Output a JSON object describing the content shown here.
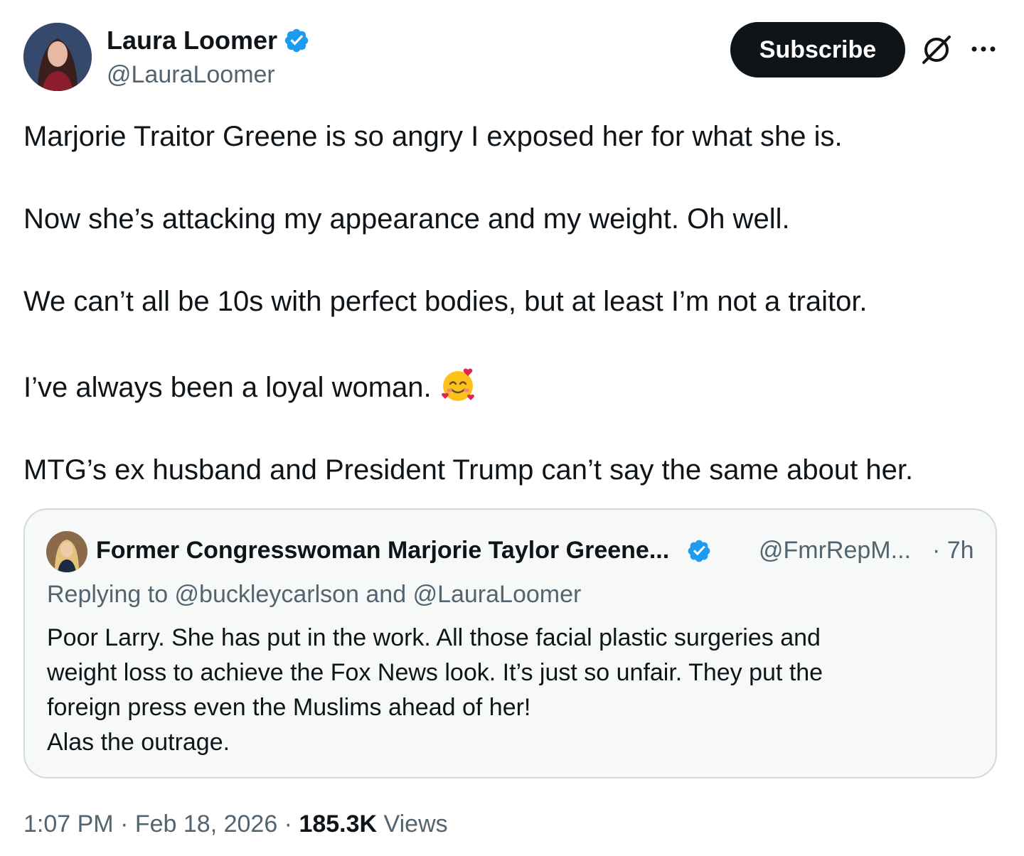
{
  "author": {
    "name": "Laura Loomer",
    "handle": "@LauraLoomer"
  },
  "actions": {
    "subscribe_label": "Subscribe"
  },
  "post": {
    "paragraphs": [
      "Marjorie Traitor Greene is so angry I exposed her for what she is.",
      "Now she’s attacking my appearance and my weight. Oh well.",
      "We can’t all be 10s with perfect bodies, but at least I’m not a traitor.",
      "I’ve always been a loyal woman.",
      "MTG’s ex husband and President Trump can’t say the same about her."
    ],
    "emoji_name": "smiling-face-with-hearts"
  },
  "quote": {
    "name": "Former Congresswoman Marjorie Taylor Greene...",
    "handle": "@FmrRepM...",
    "time": "· 7h",
    "replying_to": "Replying to @buckleycarlson and @LauraLoomer",
    "lines": [
      "Poor Larry. She has put in the work. All those facial plastic surgeries and",
      "weight loss to achieve the Fox News look. It’s just so unfair. They put the",
      "foreign press even the Muslims ahead of her!",
      "Alas the outrage."
    ]
  },
  "meta": {
    "time": "1:07 PM",
    "sep1": " · ",
    "date": "Feb 18, 2026",
    "sep2": " · ",
    "views_count": "185.3K",
    "views_label": " Views"
  },
  "colors": {
    "verified": "#1d9bf0",
    "text": "#0f1419",
    "secondary": "#536471",
    "border": "#cfd9de"
  }
}
